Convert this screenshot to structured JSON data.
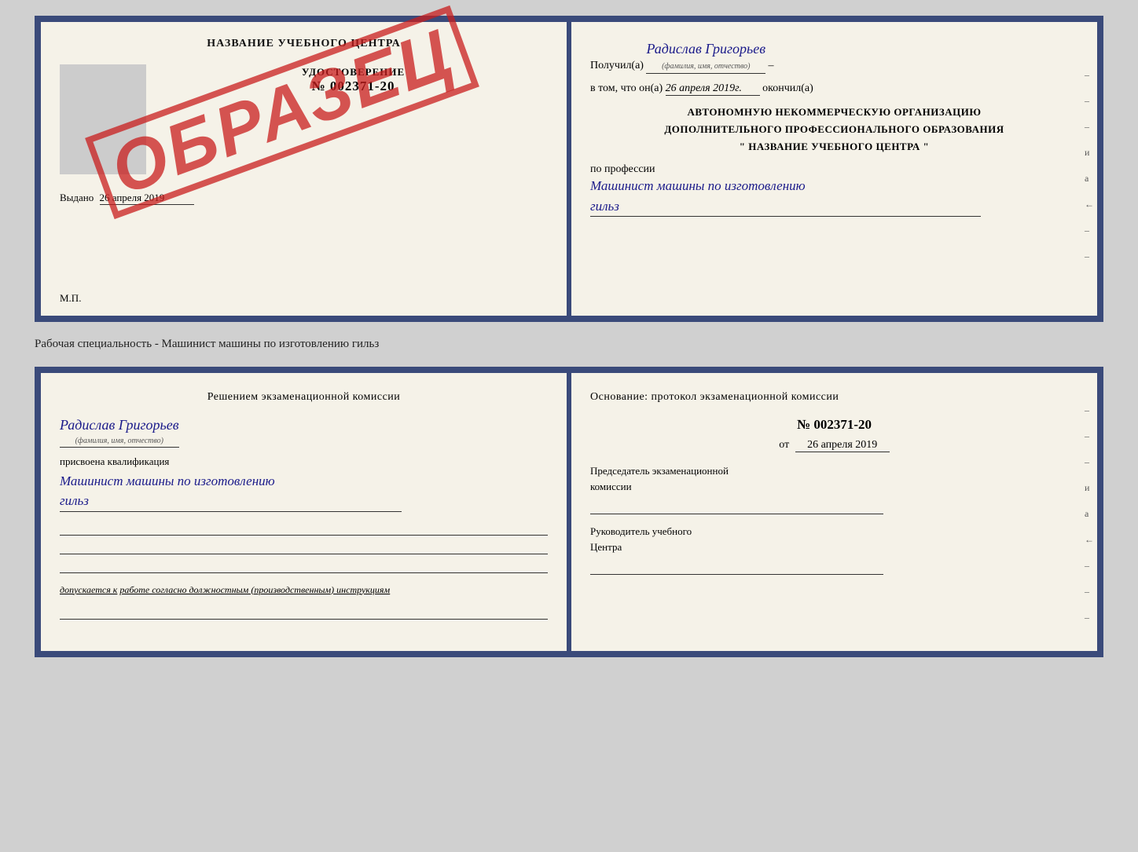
{
  "top_doc": {
    "left": {
      "title": "НАЗВАНИЕ УЧЕБНОГО ЦЕНТРА",
      "cert_label": "УДОСТОВЕРЕНИЕ",
      "cert_number": "№ 002371-20",
      "issued_label": "Выдано",
      "issued_date": "26 апреля 2019",
      "mp_label": "М.П.",
      "stamp": "ОБРАЗЕЦ"
    },
    "right": {
      "received_label": "Получил(а)",
      "name": "Радислав Григорьев",
      "fio_hint": "(фамилия, имя, отчество)",
      "date_prefix": "в том, что он(а)",
      "date_val": "26 апреля 2019г.",
      "date_suffix": "окончил(а)",
      "org_line1": "АВТОНОМНУЮ НЕКОММЕРЧЕСКУЮ ОРГАНИЗАЦИЮ",
      "org_line2": "ДОПОЛНИТЕЛЬНОГО ПРОФЕССИОНАЛЬНОГО ОБРАЗОВАНИЯ",
      "org_line3": "\" НАЗВАНИЕ УЧЕБНОГО ЦЕНТРА \"",
      "prof_label": "по профессии",
      "prof_val1": "Машинист машины по изготовлению",
      "prof_val2": "гильз",
      "side_marks": [
        "-",
        "-",
        "-",
        "и",
        "а",
        "←",
        "-",
        "-"
      ]
    }
  },
  "separator_label": "Рабочая специальность - Машинист машины по изготовлению гильз",
  "bottom_doc": {
    "left": {
      "title_line1": "Решением  экзаменационной  комиссии",
      "name": "Радислав Григорьев",
      "fio_hint": "(фамилия, имя, отчество)",
      "assigned_label": "присвоена квалификация",
      "qual_line1": "Машинист  машины  по изготовлению",
      "qual_line2": "гильз",
      "допускается_prefix": "допускается к",
      "допускается_val": "работе согласно должностным (производственным) инструкциям"
    },
    "right": {
      "basis_label": "Основание: протокол экзаменационной  комиссии",
      "number": "№  002371-20",
      "date_prefix": "от",
      "date_val": "26 апреля 2019",
      "predsed_line1": "Председатель экзаменационной",
      "predsed_line2": "комиссии",
      "rukov_line1": "Руководитель учебного",
      "rukov_line2": "Центра",
      "side_marks": [
        "-",
        "-",
        "-",
        "и",
        "а",
        "←",
        "-",
        "-",
        "-"
      ]
    }
  }
}
